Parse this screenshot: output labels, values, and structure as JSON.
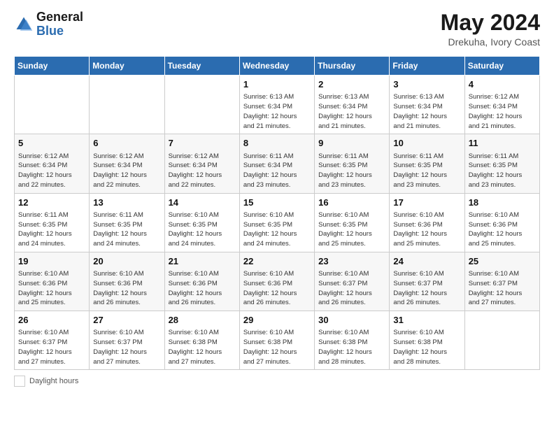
{
  "logo": {
    "line1": "General",
    "line2": "Blue"
  },
  "title": {
    "month_year": "May 2024",
    "location": "Drekuha, Ivory Coast"
  },
  "days_of_week": [
    "Sunday",
    "Monday",
    "Tuesday",
    "Wednesday",
    "Thursday",
    "Friday",
    "Saturday"
  ],
  "footer": {
    "label": "Daylight hours"
  },
  "weeks": [
    [
      {
        "day": "",
        "info": ""
      },
      {
        "day": "",
        "info": ""
      },
      {
        "day": "",
        "info": ""
      },
      {
        "day": "1",
        "info": "Sunrise: 6:13 AM\nSunset: 6:34 PM\nDaylight: 12 hours\nand 21 minutes."
      },
      {
        "day": "2",
        "info": "Sunrise: 6:13 AM\nSunset: 6:34 PM\nDaylight: 12 hours\nand 21 minutes."
      },
      {
        "day": "3",
        "info": "Sunrise: 6:13 AM\nSunset: 6:34 PM\nDaylight: 12 hours\nand 21 minutes."
      },
      {
        "day": "4",
        "info": "Sunrise: 6:12 AM\nSunset: 6:34 PM\nDaylight: 12 hours\nand 21 minutes."
      }
    ],
    [
      {
        "day": "5",
        "info": "Sunrise: 6:12 AM\nSunset: 6:34 PM\nDaylight: 12 hours\nand 22 minutes."
      },
      {
        "day": "6",
        "info": "Sunrise: 6:12 AM\nSunset: 6:34 PM\nDaylight: 12 hours\nand 22 minutes."
      },
      {
        "day": "7",
        "info": "Sunrise: 6:12 AM\nSunset: 6:34 PM\nDaylight: 12 hours\nand 22 minutes."
      },
      {
        "day": "8",
        "info": "Sunrise: 6:11 AM\nSunset: 6:34 PM\nDaylight: 12 hours\nand 23 minutes."
      },
      {
        "day": "9",
        "info": "Sunrise: 6:11 AM\nSunset: 6:35 PM\nDaylight: 12 hours\nand 23 minutes."
      },
      {
        "day": "10",
        "info": "Sunrise: 6:11 AM\nSunset: 6:35 PM\nDaylight: 12 hours\nand 23 minutes."
      },
      {
        "day": "11",
        "info": "Sunrise: 6:11 AM\nSunset: 6:35 PM\nDaylight: 12 hours\nand 23 minutes."
      }
    ],
    [
      {
        "day": "12",
        "info": "Sunrise: 6:11 AM\nSunset: 6:35 PM\nDaylight: 12 hours\nand 24 minutes."
      },
      {
        "day": "13",
        "info": "Sunrise: 6:11 AM\nSunset: 6:35 PM\nDaylight: 12 hours\nand 24 minutes."
      },
      {
        "day": "14",
        "info": "Sunrise: 6:10 AM\nSunset: 6:35 PM\nDaylight: 12 hours\nand 24 minutes."
      },
      {
        "day": "15",
        "info": "Sunrise: 6:10 AM\nSunset: 6:35 PM\nDaylight: 12 hours\nand 24 minutes."
      },
      {
        "day": "16",
        "info": "Sunrise: 6:10 AM\nSunset: 6:35 PM\nDaylight: 12 hours\nand 25 minutes."
      },
      {
        "day": "17",
        "info": "Sunrise: 6:10 AM\nSunset: 6:36 PM\nDaylight: 12 hours\nand 25 minutes."
      },
      {
        "day": "18",
        "info": "Sunrise: 6:10 AM\nSunset: 6:36 PM\nDaylight: 12 hours\nand 25 minutes."
      }
    ],
    [
      {
        "day": "19",
        "info": "Sunrise: 6:10 AM\nSunset: 6:36 PM\nDaylight: 12 hours\nand 25 minutes."
      },
      {
        "day": "20",
        "info": "Sunrise: 6:10 AM\nSunset: 6:36 PM\nDaylight: 12 hours\nand 26 minutes."
      },
      {
        "day": "21",
        "info": "Sunrise: 6:10 AM\nSunset: 6:36 PM\nDaylight: 12 hours\nand 26 minutes."
      },
      {
        "day": "22",
        "info": "Sunrise: 6:10 AM\nSunset: 6:36 PM\nDaylight: 12 hours\nand 26 minutes."
      },
      {
        "day": "23",
        "info": "Sunrise: 6:10 AM\nSunset: 6:37 PM\nDaylight: 12 hours\nand 26 minutes."
      },
      {
        "day": "24",
        "info": "Sunrise: 6:10 AM\nSunset: 6:37 PM\nDaylight: 12 hours\nand 26 minutes."
      },
      {
        "day": "25",
        "info": "Sunrise: 6:10 AM\nSunset: 6:37 PM\nDaylight: 12 hours\nand 27 minutes."
      }
    ],
    [
      {
        "day": "26",
        "info": "Sunrise: 6:10 AM\nSunset: 6:37 PM\nDaylight: 12 hours\nand 27 minutes."
      },
      {
        "day": "27",
        "info": "Sunrise: 6:10 AM\nSunset: 6:37 PM\nDaylight: 12 hours\nand 27 minutes."
      },
      {
        "day": "28",
        "info": "Sunrise: 6:10 AM\nSunset: 6:38 PM\nDaylight: 12 hours\nand 27 minutes."
      },
      {
        "day": "29",
        "info": "Sunrise: 6:10 AM\nSunset: 6:38 PM\nDaylight: 12 hours\nand 27 minutes."
      },
      {
        "day": "30",
        "info": "Sunrise: 6:10 AM\nSunset: 6:38 PM\nDaylight: 12 hours\nand 28 minutes."
      },
      {
        "day": "31",
        "info": "Sunrise: 6:10 AM\nSunset: 6:38 PM\nDaylight: 12 hours\nand 28 minutes."
      },
      {
        "day": "",
        "info": ""
      }
    ]
  ]
}
